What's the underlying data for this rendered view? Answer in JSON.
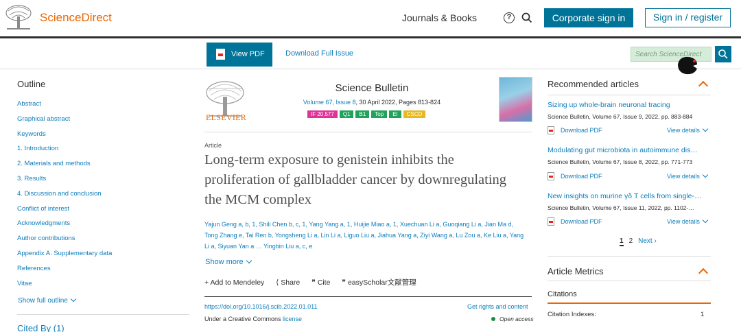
{
  "header": {
    "brand": "ScienceDirect",
    "journals_books": "Journals & Books",
    "help_glyph": "?",
    "corporate_signin": "Corporate sign in",
    "signin_register": "Sign in / register"
  },
  "toolbar": {
    "view_pdf": "View PDF",
    "download_full_issue": "Download Full Issue",
    "search_placeholder": "Search ScienceDirect"
  },
  "outline": {
    "title": "Outline",
    "items": [
      "Abstract",
      "Graphical abstract",
      "Keywords",
      "1. Introduction",
      "2. Materials and methods",
      "3. Results",
      "4. Discussion and conclusion",
      "Conflict of interest",
      "Acknowledgments",
      "Author contributions",
      "Appendix A. Supplementary data",
      "References",
      "Vitae"
    ],
    "show_full": "Show full outline",
    "cited_by": "Cited By (1)"
  },
  "journal": {
    "publisher_logo_text": "ELSEVIER",
    "title": "Science Bulletin",
    "volume_link": "Volume 67, Issue 8",
    "volume_rest": ", 30 April 2022, Pages 813-824",
    "badges": [
      {
        "label": "IF 20.577",
        "color": "#e0339a"
      },
      {
        "label": "Q1",
        "color": "#21a35b"
      },
      {
        "label": "B1",
        "color": "#21a35b"
      },
      {
        "label": "Top",
        "color": "#21a35b"
      },
      {
        "label": "EI",
        "color": "#21a35b"
      },
      {
        "label": "CSCD",
        "color": "#e6b821"
      }
    ]
  },
  "article": {
    "type": "Article",
    "title": "Long-term exposure to genistein inhibits the proliferation of gallbladder cancer by downregulating the MCM complex",
    "authors": "Yajun Geng a, b, 1, Shili Chen b, c, 1, Yang Yang a, 1, Huijie Miao a, 1, Xuechuan Li a, Guoqiang Li a, Jian Ma d, Tong Zhang e, Tai Ren b, Yongsheng Li a, Lin Li a, Liguo Liu a, Jiahua Yang a, Ziyi Wang a, Lu Zou a, Ke Liu a, Yang Li a, Siyuan Yan a … Yingbin Liu a, c, e",
    "show_more": "Show more",
    "actions": [
      "Add to Mendeley",
      "Share",
      "Cite",
      "easyScholar文献管理"
    ],
    "doi": "https://doi.org/10.1016/j.scib.2022.01.011",
    "get_rights": "Get rights and content",
    "cc_prefix": "Under a Creative Commons ",
    "cc_link": "license",
    "open_access": "Open access"
  },
  "recommended": {
    "title": "Recommended articles",
    "items": [
      {
        "title": "Sizing up whole-brain neuronal tracing",
        "meta": "Science Bulletin, Volume 67, Issue 9, 2022, pp. 883-884",
        "pdf": "Download PDF",
        "details": "View details"
      },
      {
        "title": "Modulating gut microbiota in autoimmune dis…",
        "meta": "Science Bulletin, Volume 67, Issue 8, 2022, pp. 771-773",
        "pdf": "Download PDF",
        "details": "View details"
      },
      {
        "title": "New insights on murine γδ T cells from single-…",
        "meta": "Science Bulletin, Volume 67, Issue 11, 2022, pp. 1102-…",
        "pdf": "Download PDF",
        "details": "View details"
      }
    ],
    "pager": {
      "current": "1",
      "page2": "2",
      "next": "Next"
    }
  },
  "metrics": {
    "title": "Article Metrics",
    "citations": "Citations",
    "citation_indexes": "Citation Indexes:",
    "citation_indexes_value": "1"
  }
}
